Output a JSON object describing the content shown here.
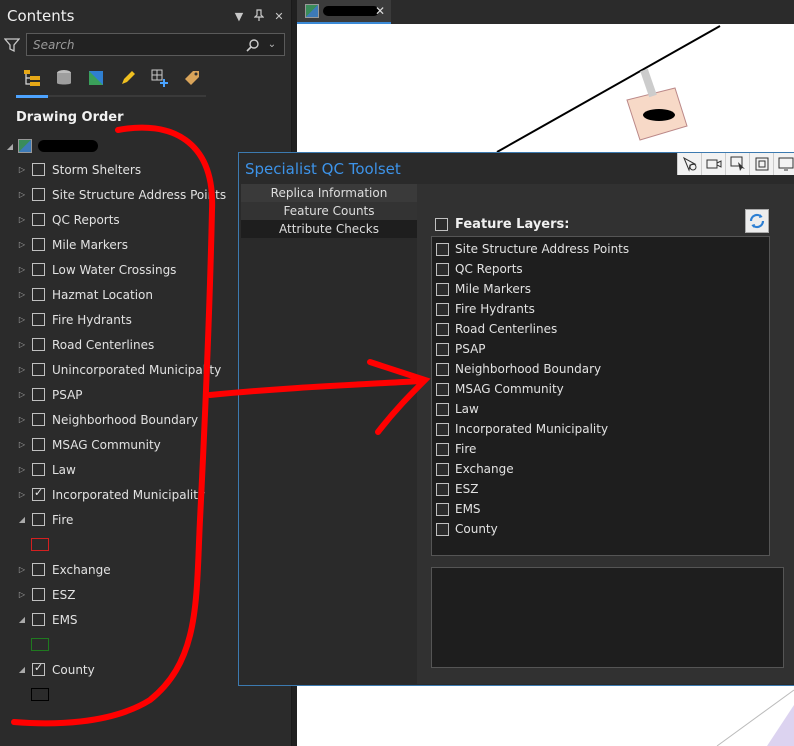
{
  "contents_pane": {
    "title": "Contents",
    "search_placeholder": "Search",
    "drawing_order_label": "Drawing Order",
    "layers": [
      {
        "label": "Storm Shelters",
        "checked": false,
        "expanded": false
      },
      {
        "label": "Site Structure Address Points",
        "checked": false,
        "expanded": false
      },
      {
        "label": "QC Reports",
        "checked": false,
        "expanded": false
      },
      {
        "label": "Mile Markers",
        "checked": false,
        "expanded": false
      },
      {
        "label": "Low Water Crossings",
        "checked": false,
        "expanded": false
      },
      {
        "label": "Hazmat Location",
        "checked": false,
        "expanded": false
      },
      {
        "label": "Fire Hydrants",
        "checked": false,
        "expanded": false
      },
      {
        "label": "Road Centerlines",
        "checked": false,
        "expanded": false
      },
      {
        "label": "Unincorporated Municipality",
        "checked": false,
        "expanded": false
      },
      {
        "label": "PSAP",
        "checked": false,
        "expanded": false
      },
      {
        "label": "Neighborhood Boundary",
        "checked": false,
        "expanded": false
      },
      {
        "label": "MSAG Community",
        "checked": false,
        "expanded": false
      },
      {
        "label": "Law",
        "checked": false,
        "expanded": false
      },
      {
        "label": "Incorporated Municipality",
        "checked": true,
        "expanded": false
      },
      {
        "label": "Fire",
        "checked": false,
        "expanded": true,
        "symbol_color": "#d42020"
      },
      {
        "label": "Exchange",
        "checked": false,
        "expanded": false
      },
      {
        "label": "ESZ",
        "checked": false,
        "expanded": false
      },
      {
        "label": "EMS",
        "checked": false,
        "expanded": true,
        "symbol_color": "#1f7a1f"
      },
      {
        "label": "County",
        "checked": true,
        "expanded": true,
        "symbol_color": "#111111"
      }
    ]
  },
  "toolset": {
    "title": "Specialist QC Toolset",
    "tabs": [
      "Replica Information",
      "Feature Counts",
      "Attribute Checks"
    ],
    "feature_layers_label": "Feature Layers:",
    "feature_layers": [
      "Site Structure Address Points",
      "QC Reports",
      "Mile Markers",
      "Fire Hydrants",
      "Road Centerlines",
      "PSAP",
      "Neighborhood Boundary",
      "MSAG Community",
      "Law",
      "Incorporated Municipality",
      "Fire",
      "Exchange",
      "ESZ",
      "EMS",
      "County"
    ]
  },
  "colors": {
    "accent": "#3d93e8",
    "annotation": "#ff0000"
  }
}
